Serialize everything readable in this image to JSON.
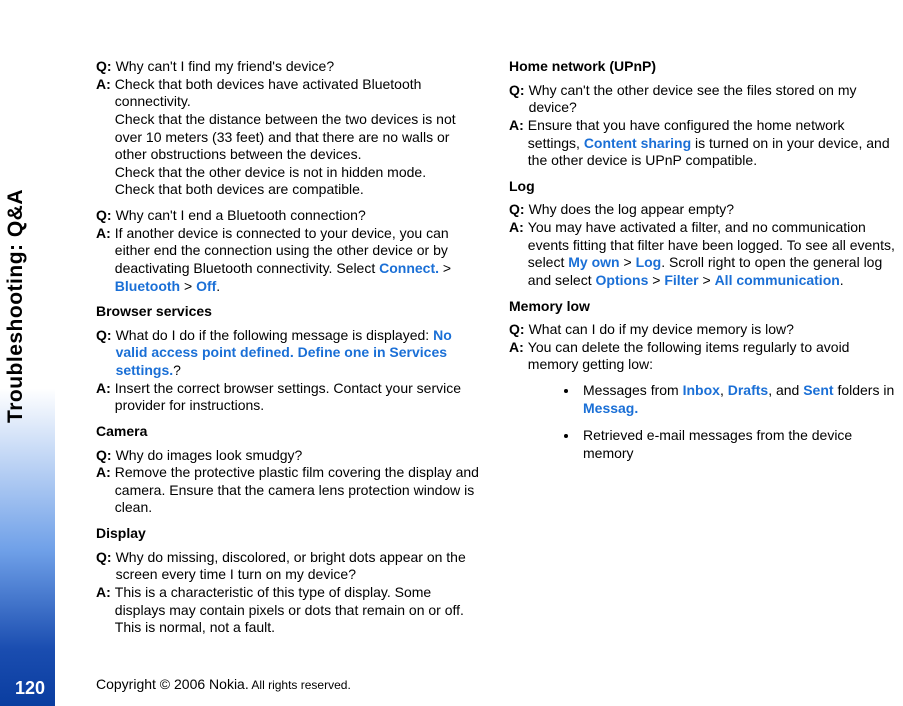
{
  "side": {
    "title": "Troubleshooting: Q&A",
    "page_num": "120"
  },
  "footer": {
    "copyright": "Copyright © 2006 Nokia.",
    "rights": " All rights reserved."
  },
  "qa1": {
    "q": "Why can't I find my friend's device?",
    "a1": "Check that both devices have activated Bluetooth connectivity.",
    "a2": "Check that the distance between the two devices is not over 10 meters (33 feet) and that there are no walls or other obstructions between the devices.",
    "a3": "Check that the other device is not in hidden mode.",
    "a4": "Check that both devices are compatible."
  },
  "qa2": {
    "q": "Why can't I end a Bluetooth connection?",
    "a_pre": "If another device is connected to your device, you can either end the connection using the other device or by deactivating Bluetooth connectivity. Select ",
    "connect": "Connect.",
    "gt1": " > ",
    "bt": "Bluetooth",
    "gt2": " > ",
    "off": "Off",
    "dot": "."
  },
  "sec_browser": "Browser services",
  "qa3": {
    "q_pre": "What do I do if the following message is displayed: ",
    "q_hl": "No valid access point defined. Define one in Services settings.",
    "q_post": "?",
    "a": "Insert the correct browser settings. Contact your service provider for instructions."
  },
  "sec_camera": "Camera",
  "qa4": {
    "q": "Why do images look smudgy?",
    "a": "Remove the protective plastic film covering the display and camera. Ensure that the camera lens protection window is clean."
  },
  "sec_display": "Display",
  "qa5": {
    "q": "Why do missing, discolored, or bright dots appear on the screen every time I turn on my device?",
    "a": "This is a characteristic of this type of display. Some displays may contain pixels or dots that remain on or off. This is normal, not a fault."
  },
  "sec_upnp": "Home network (UPnP)",
  "qa6": {
    "q": "Why can't the other device see the files stored on my device?",
    "a_pre": "Ensure that you have configured the home network settings, ",
    "hl": "Content sharing",
    "a_post": " is turned on in your device, and the other device is UPnP compatible."
  },
  "sec_log": "Log",
  "qa7": {
    "q": "Why does the log appear empty?",
    "a_pre": "You may have activated a filter, and no communication events fitting that filter have been logged. To see all events, select ",
    "myown": "My own",
    "gt1": " > ",
    "log": "Log",
    "mid": ". Scroll right to open the general log and select ",
    "options": "Options",
    "gt2": " > ",
    "filter": "Filter",
    "gt3": " > ",
    "allcomm": "All communication",
    "dot": "."
  },
  "sec_memory": "Memory low",
  "qa8": {
    "q": "What can I do if my device memory is low?",
    "a": "You can delete the following items regularly to avoid memory getting low:"
  },
  "bul1": {
    "pre": "Messages from ",
    "inbox": "Inbox",
    "c1": ", ",
    "drafts": "Drafts",
    "c2": ", and ",
    "sent": "Sent",
    "mid": " folders in ",
    "messag": "Messag."
  },
  "bul2": "Retrieved e-mail messages from the device memory",
  "labels": {
    "q": "Q:",
    "a": "A:"
  }
}
